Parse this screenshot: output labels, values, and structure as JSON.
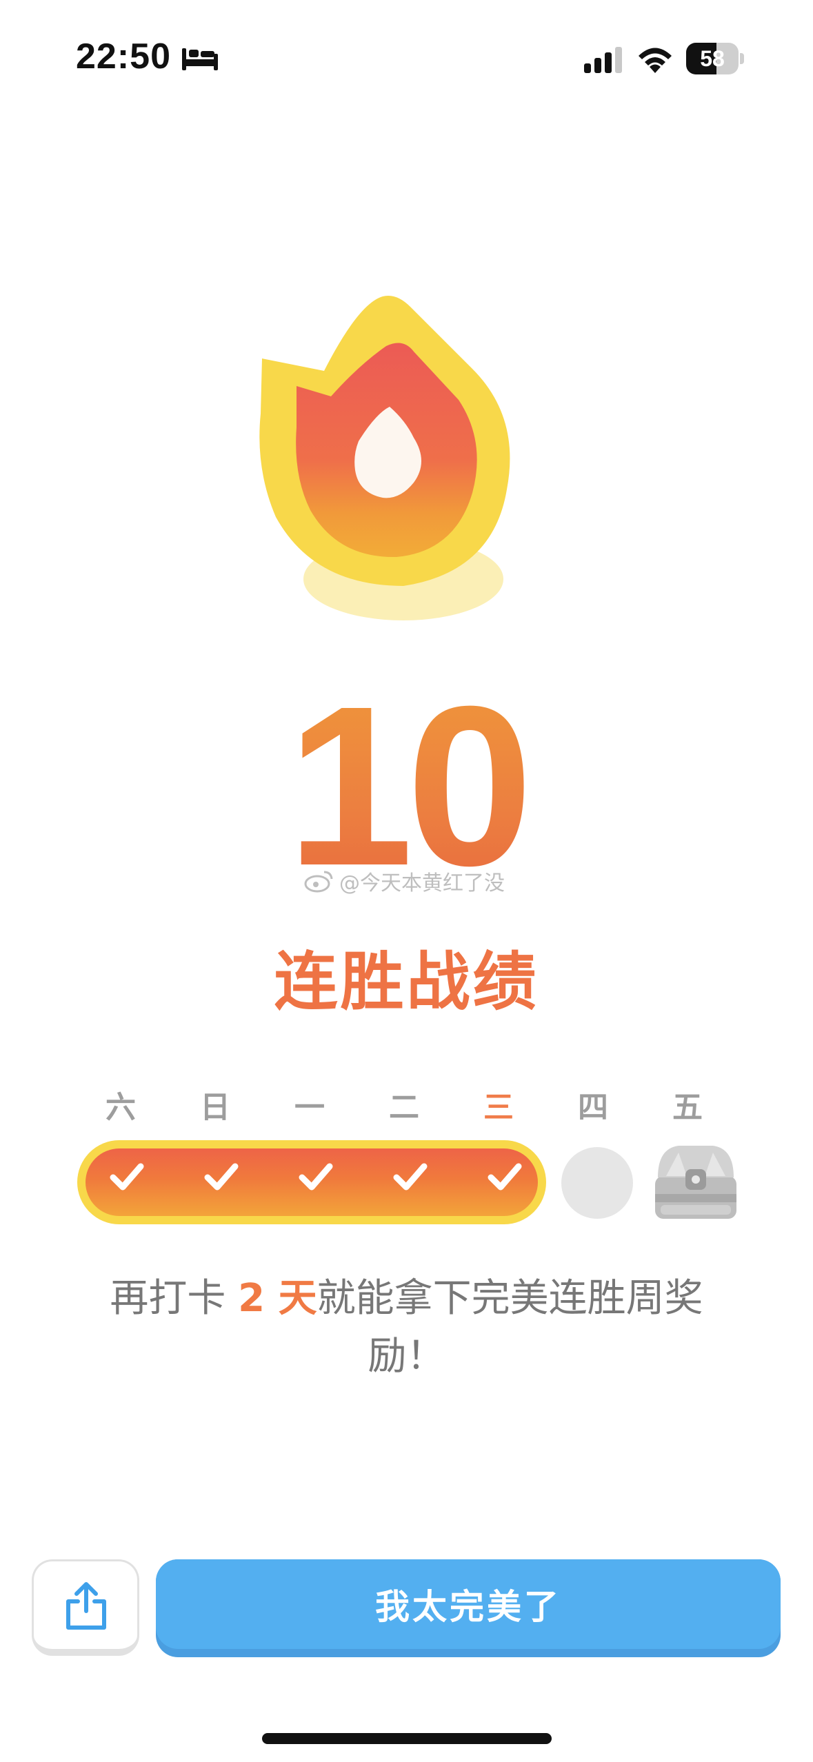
{
  "status_bar": {
    "time": "22:50",
    "battery_level": "58",
    "icons": [
      "bed-icon",
      "cellular-signal-icon",
      "wifi-icon",
      "battery-icon"
    ]
  },
  "streak": {
    "count": "10",
    "title": "连胜战绩",
    "watermark": "@今天本黄红了没"
  },
  "week": {
    "days": [
      {
        "label": "六",
        "state": "done"
      },
      {
        "label": "日",
        "state": "done"
      },
      {
        "label": "一",
        "state": "done"
      },
      {
        "label": "二",
        "state": "done"
      },
      {
        "label": "三",
        "state": "done",
        "today": true
      },
      {
        "label": "四",
        "state": "pending"
      },
      {
        "label": "五",
        "state": "reward"
      }
    ]
  },
  "message": {
    "prefix": "再打卡 ",
    "highlight": "2 天",
    "suffix": "就能拿下完美连胜周奖励！"
  },
  "actions": {
    "share_icon": "share-icon",
    "primary_label": "我太完美了"
  },
  "colors": {
    "accent_orange": "#ee7344",
    "flame_yellow": "#f8d84a",
    "button_blue": "#53aff0"
  }
}
